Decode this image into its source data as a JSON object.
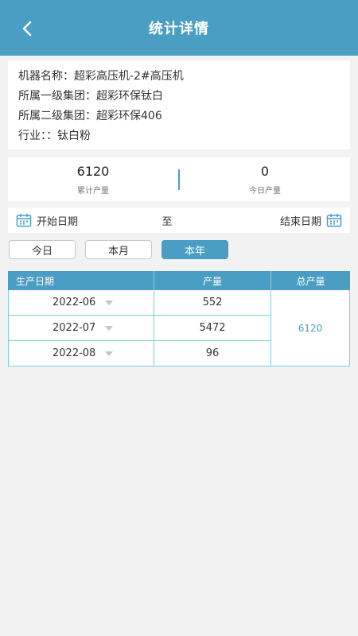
{
  "header": {
    "title": "统计详情",
    "back_icon": "chevron-left-icon"
  },
  "info": {
    "machine_name": "机器名称：超彩高压机-2#高压机",
    "group_level1": "所属一级集团：超彩环保钛白",
    "group_level2": "所属二级集团：超彩环保406",
    "industry": "行业：：钛白粉"
  },
  "stats": {
    "cumulative_value": "6120",
    "cumulative_label": "累计产量",
    "today_value": "0",
    "today_label": "今日产量"
  },
  "date_range": {
    "start_label": "开始日期",
    "separator": "至",
    "end_label": "结束日期",
    "icon": "calendar-icon"
  },
  "filters": {
    "today": "今日",
    "month": "本月",
    "year": "本年",
    "active": "year"
  },
  "table": {
    "headers": {
      "date": "生产日期",
      "output": "产量",
      "total": "总产量"
    },
    "rows": [
      {
        "date": "2022-06",
        "output": "552"
      },
      {
        "date": "2022-07",
        "output": "5472"
      },
      {
        "date": "2022-08",
        "output": "96"
      }
    ],
    "total": "6120"
  },
  "colors": {
    "accent": "#4a9ec4",
    "table_border": "#7ccdda",
    "background": "#f2f2f2"
  }
}
